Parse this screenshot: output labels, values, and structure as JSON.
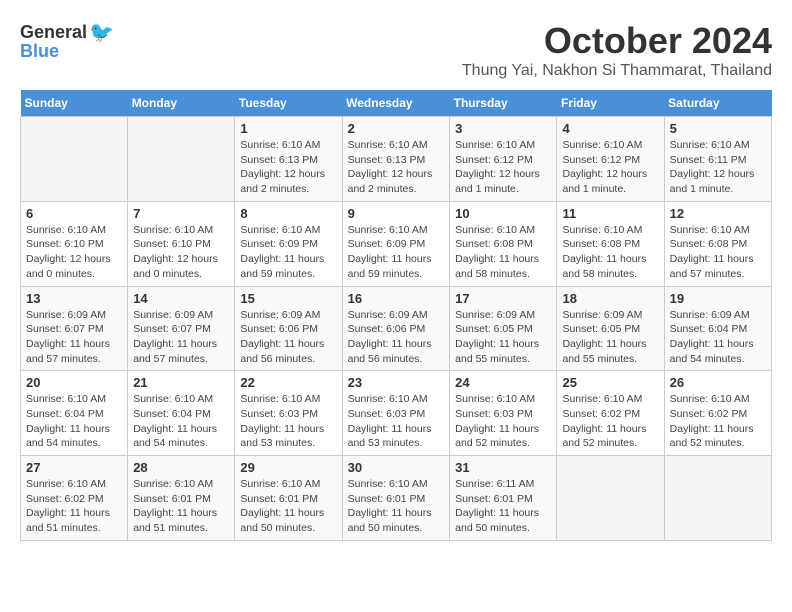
{
  "header": {
    "logo_general": "General",
    "logo_blue": "Blue",
    "month": "October 2024",
    "location": "Thung Yai, Nakhon Si Thammarat, Thailand"
  },
  "days_of_week": [
    "Sunday",
    "Monday",
    "Tuesday",
    "Wednesday",
    "Thursday",
    "Friday",
    "Saturday"
  ],
  "weeks": [
    [
      {
        "day": "",
        "details": ""
      },
      {
        "day": "",
        "details": ""
      },
      {
        "day": "1",
        "details": "Sunrise: 6:10 AM\nSunset: 6:13 PM\nDaylight: 12 hours and 2 minutes."
      },
      {
        "day": "2",
        "details": "Sunrise: 6:10 AM\nSunset: 6:13 PM\nDaylight: 12 hours and 2 minutes."
      },
      {
        "day": "3",
        "details": "Sunrise: 6:10 AM\nSunset: 6:12 PM\nDaylight: 12 hours and 1 minute."
      },
      {
        "day": "4",
        "details": "Sunrise: 6:10 AM\nSunset: 6:12 PM\nDaylight: 12 hours and 1 minute."
      },
      {
        "day": "5",
        "details": "Sunrise: 6:10 AM\nSunset: 6:11 PM\nDaylight: 12 hours and 1 minute."
      }
    ],
    [
      {
        "day": "6",
        "details": "Sunrise: 6:10 AM\nSunset: 6:10 PM\nDaylight: 12 hours and 0 minutes."
      },
      {
        "day": "7",
        "details": "Sunrise: 6:10 AM\nSunset: 6:10 PM\nDaylight: 12 hours and 0 minutes."
      },
      {
        "day": "8",
        "details": "Sunrise: 6:10 AM\nSunset: 6:09 PM\nDaylight: 11 hours and 59 minutes."
      },
      {
        "day": "9",
        "details": "Sunrise: 6:10 AM\nSunset: 6:09 PM\nDaylight: 11 hours and 59 minutes."
      },
      {
        "day": "10",
        "details": "Sunrise: 6:10 AM\nSunset: 6:08 PM\nDaylight: 11 hours and 58 minutes."
      },
      {
        "day": "11",
        "details": "Sunrise: 6:10 AM\nSunset: 6:08 PM\nDaylight: 11 hours and 58 minutes."
      },
      {
        "day": "12",
        "details": "Sunrise: 6:10 AM\nSunset: 6:08 PM\nDaylight: 11 hours and 57 minutes."
      }
    ],
    [
      {
        "day": "13",
        "details": "Sunrise: 6:09 AM\nSunset: 6:07 PM\nDaylight: 11 hours and 57 minutes."
      },
      {
        "day": "14",
        "details": "Sunrise: 6:09 AM\nSunset: 6:07 PM\nDaylight: 11 hours and 57 minutes."
      },
      {
        "day": "15",
        "details": "Sunrise: 6:09 AM\nSunset: 6:06 PM\nDaylight: 11 hours and 56 minutes."
      },
      {
        "day": "16",
        "details": "Sunrise: 6:09 AM\nSunset: 6:06 PM\nDaylight: 11 hours and 56 minutes."
      },
      {
        "day": "17",
        "details": "Sunrise: 6:09 AM\nSunset: 6:05 PM\nDaylight: 11 hours and 55 minutes."
      },
      {
        "day": "18",
        "details": "Sunrise: 6:09 AM\nSunset: 6:05 PM\nDaylight: 11 hours and 55 minutes."
      },
      {
        "day": "19",
        "details": "Sunrise: 6:09 AM\nSunset: 6:04 PM\nDaylight: 11 hours and 54 minutes."
      }
    ],
    [
      {
        "day": "20",
        "details": "Sunrise: 6:10 AM\nSunset: 6:04 PM\nDaylight: 11 hours and 54 minutes."
      },
      {
        "day": "21",
        "details": "Sunrise: 6:10 AM\nSunset: 6:04 PM\nDaylight: 11 hours and 54 minutes."
      },
      {
        "day": "22",
        "details": "Sunrise: 6:10 AM\nSunset: 6:03 PM\nDaylight: 11 hours and 53 minutes."
      },
      {
        "day": "23",
        "details": "Sunrise: 6:10 AM\nSunset: 6:03 PM\nDaylight: 11 hours and 53 minutes."
      },
      {
        "day": "24",
        "details": "Sunrise: 6:10 AM\nSunset: 6:03 PM\nDaylight: 11 hours and 52 minutes."
      },
      {
        "day": "25",
        "details": "Sunrise: 6:10 AM\nSunset: 6:02 PM\nDaylight: 11 hours and 52 minutes."
      },
      {
        "day": "26",
        "details": "Sunrise: 6:10 AM\nSunset: 6:02 PM\nDaylight: 11 hours and 52 minutes."
      }
    ],
    [
      {
        "day": "27",
        "details": "Sunrise: 6:10 AM\nSunset: 6:02 PM\nDaylight: 11 hours and 51 minutes."
      },
      {
        "day": "28",
        "details": "Sunrise: 6:10 AM\nSunset: 6:01 PM\nDaylight: 11 hours and 51 minutes."
      },
      {
        "day": "29",
        "details": "Sunrise: 6:10 AM\nSunset: 6:01 PM\nDaylight: 11 hours and 50 minutes."
      },
      {
        "day": "30",
        "details": "Sunrise: 6:10 AM\nSunset: 6:01 PM\nDaylight: 11 hours and 50 minutes."
      },
      {
        "day": "31",
        "details": "Sunrise: 6:11 AM\nSunset: 6:01 PM\nDaylight: 11 hours and 50 minutes."
      },
      {
        "day": "",
        "details": ""
      },
      {
        "day": "",
        "details": ""
      }
    ]
  ]
}
